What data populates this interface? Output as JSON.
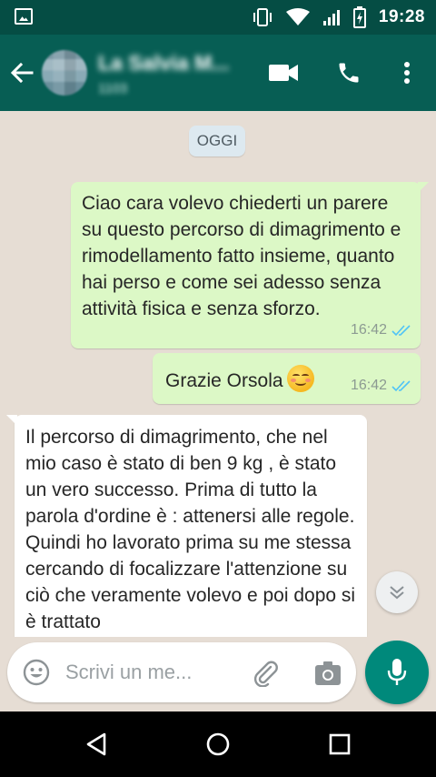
{
  "status_bar": {
    "time": "19:28"
  },
  "header": {
    "contact_name": "La Salvia M...",
    "contact_status": "1103"
  },
  "chat": {
    "date_chip": "OGGI",
    "messages": [
      {
        "direction": "outgoing",
        "text": "Ciao cara volevo chiederti un parere su questo percorso di dimagrimento e rimodellamento fatto insieme, quanto hai perso e come sei adesso senza attività fisica e senza sforzo.",
        "time": "16:42",
        "status": "delivered"
      },
      {
        "direction": "outgoing",
        "text": "Grazie Orsola",
        "emoji": "smiling-face-with-smiling-eyes",
        "time": "16:42",
        "status": "delivered"
      },
      {
        "direction": "incoming",
        "text": "Il percorso di dimagrimento, che nel mio caso è stato di ben 9 kg , è stato un vero successo. Prima di tutto la parola d'ordine è : attenersi alle regole. Quindi ho lavorato prima su me stessa cercando di focalizzare l'attenzione su ciò che veramente volevo e poi dopo si è trattato"
      }
    ]
  },
  "composer": {
    "placeholder": "Scrivi un me..."
  },
  "colors": {
    "header": "#075e54",
    "status_bar": "#054d44",
    "outgoing_bubble": "#dcf8c6",
    "incoming_bubble": "#ffffff",
    "mic_button": "#00897b",
    "read_ticks": "#4fc3f7"
  },
  "icons": [
    "image-icon",
    "vibrate-icon",
    "wifi-icon",
    "signal-icon",
    "battery-icon",
    "back-arrow-icon",
    "video-call-icon",
    "phone-icon",
    "more-vert-icon",
    "double-check-icon",
    "chevron-double-down-icon",
    "emoji-icon",
    "paperclip-icon",
    "camera-icon",
    "mic-icon",
    "nav-back-icon",
    "nav-home-icon",
    "nav-recents-icon"
  ]
}
